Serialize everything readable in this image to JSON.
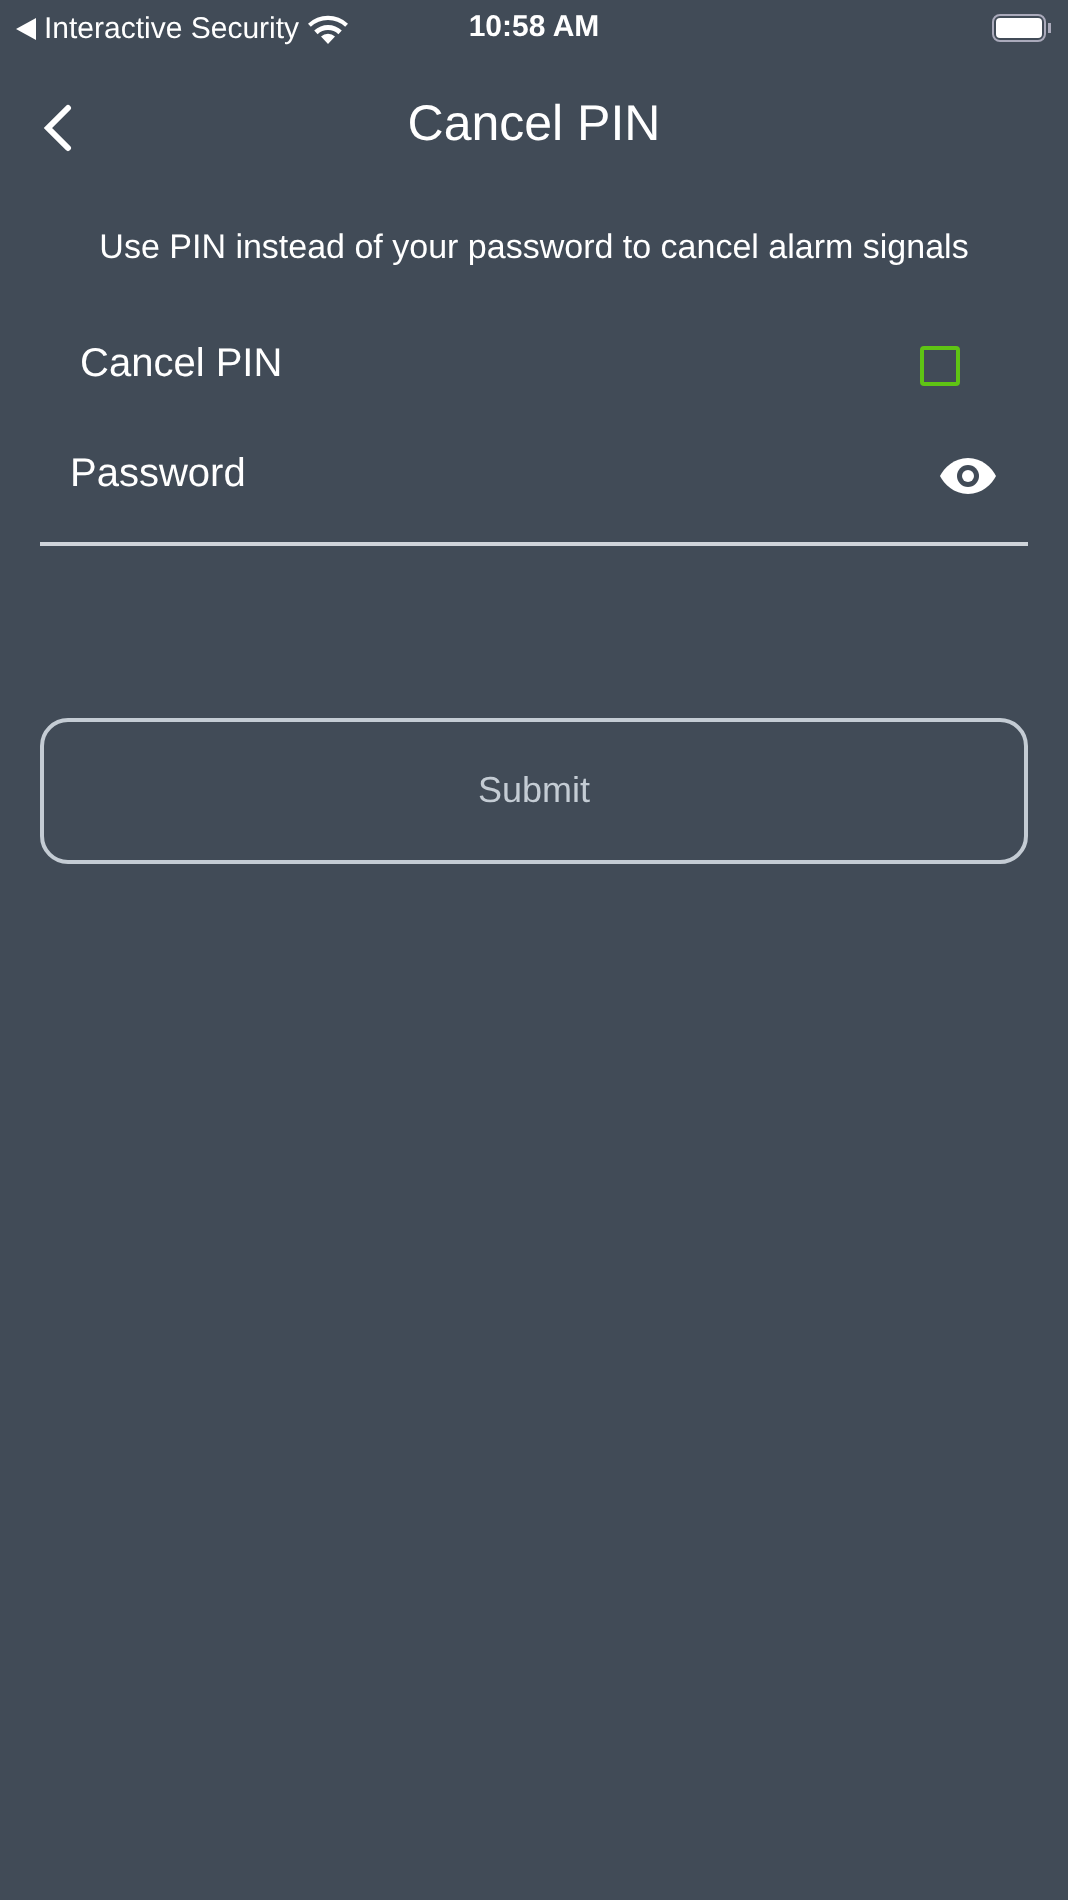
{
  "status_bar": {
    "back_app": "Interactive Security",
    "time": "10:58 AM"
  },
  "nav": {
    "title": "Cancel PIN"
  },
  "description": "Use PIN instead of your password to cancel alarm signals",
  "cancel_pin": {
    "label": "Cancel PIN",
    "checked": false
  },
  "password": {
    "placeholder": "Password"
  },
  "submit": {
    "label": "Submit",
    "disabled": true
  }
}
